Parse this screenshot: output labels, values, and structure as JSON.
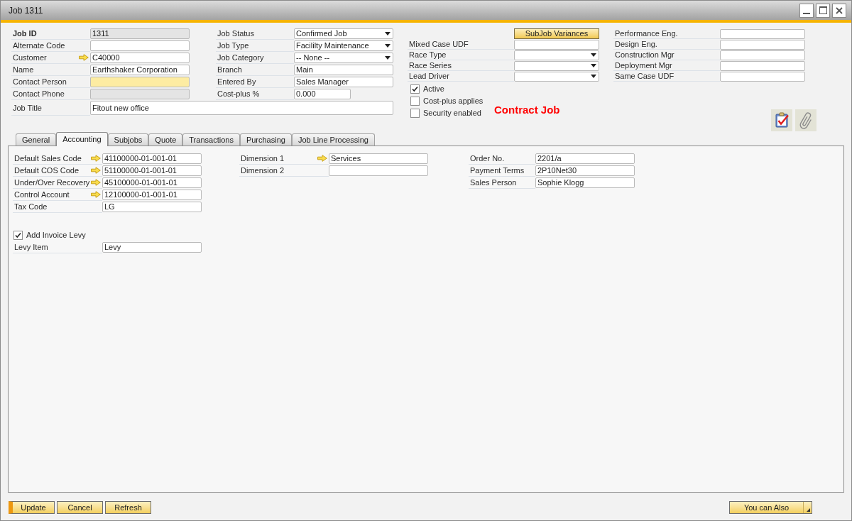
{
  "window": {
    "title": "Job 1311"
  },
  "header": {
    "job_id": {
      "label": "Job ID",
      "value": "1311",
      "readonly": true
    },
    "column_1": [
      {
        "label": "Alternate Code",
        "readonly": false,
        "required": false,
        "link": false
      },
      {
        "label": "Customer",
        "value": "C40000",
        "readonly": false,
        "required": false,
        "link": true
      },
      {
        "label": "Name",
        "value": "Earthshaker Corporation",
        "readonly": false,
        "required": false,
        "link": false
      },
      {
        "label": "Contact Person",
        "readonly": false,
        "required": true,
        "link": false
      },
      {
        "label": "Contact Phone",
        "readonly": true,
        "required": false,
        "link": false
      }
    ],
    "column_2": [
      {
        "label": "Job Status",
        "kind": "dropdown",
        "value": "Confirmed Job"
      },
      {
        "label": "Job Type",
        "kind": "dropdown",
        "value": "Facililty Maintenance"
      },
      {
        "label": "Job Category",
        "kind": "dropdown",
        "value": "-- None --"
      },
      {
        "label": "Branch",
        "kind": "input",
        "value": "Main"
      },
      {
        "label": "Entered By",
        "kind": "input",
        "value": "Sales Manager"
      },
      {
        "label": "Cost-plus %",
        "kind": "short_input",
        "value": "0.000"
      }
    ],
    "job_title": {
      "label": "Job Title",
      "value": "Fitout new office"
    },
    "subjob_variances_button": "SubJob Variances",
    "column_3": [
      {
        "label": "Mixed Case UDF",
        "kind": "input"
      },
      {
        "label": "Race Type",
        "kind": "dropdown"
      },
      {
        "label": "Race Series",
        "kind": "dropdown"
      },
      {
        "label": "Lead Driver",
        "kind": "dropdown"
      }
    ],
    "checkboxes": [
      {
        "label": "Active",
        "checked": true
      },
      {
        "label": "Cost-plus applies",
        "checked": false
      },
      {
        "label": "Security enabled",
        "checked": false
      }
    ],
    "contract_label": "Contract Job",
    "column_4": [
      {
        "label": "Performance Eng."
      },
      {
        "label": "Design Eng."
      },
      {
        "label": "Construction Mgr"
      },
      {
        "label": "Deployment Mgr"
      },
      {
        "label": "Same Case UDF"
      }
    ]
  },
  "tabs": [
    {
      "label": "General",
      "selected": false
    },
    {
      "label": "Accounting",
      "selected": true
    },
    {
      "label": "Subjobs",
      "selected": false
    },
    {
      "label": "Quote",
      "selected": false
    },
    {
      "label": "Transactions",
      "selected": false
    },
    {
      "label": "Purchasing",
      "selected": false
    },
    {
      "label": "Job Line Processing",
      "selected": false
    }
  ],
  "accounting": {
    "column_1": [
      {
        "label": "Default Sales Code",
        "value": "41100000-01-001-01",
        "link": true
      },
      {
        "label": "Default COS Code",
        "value": "51100000-01-001-01",
        "link": true
      },
      {
        "label": "Under/Over Recovery",
        "value": "45100000-01-001-01",
        "link": true
      },
      {
        "label": "Control Account",
        "value": "12100000-01-001-01",
        "link": true
      },
      {
        "label": "Tax Code",
        "value": "LG",
        "link": false
      }
    ],
    "levy_checkbox": {
      "label": "Add Invoice Levy",
      "checked": true
    },
    "levy_item": {
      "label": "Levy Item",
      "value": "Levy"
    },
    "column_2": [
      {
        "label": "Dimension 1",
        "value": "Services",
        "link": true
      },
      {
        "label": "Dimension 2",
        "link": false
      }
    ],
    "column_3": [
      {
        "label": "Order No.",
        "value": "2201/a"
      },
      {
        "label": "Payment Terms",
        "value": "2P10Net30"
      },
      {
        "label": "Sales Person",
        "value": "Sophie Klogg"
      }
    ]
  },
  "footer": {
    "buttons": [
      {
        "label": "Update",
        "primary": true
      },
      {
        "label": "Cancel",
        "primary": false
      },
      {
        "label": "Refresh",
        "primary": false
      }
    ],
    "menu_button": "You can Also"
  }
}
